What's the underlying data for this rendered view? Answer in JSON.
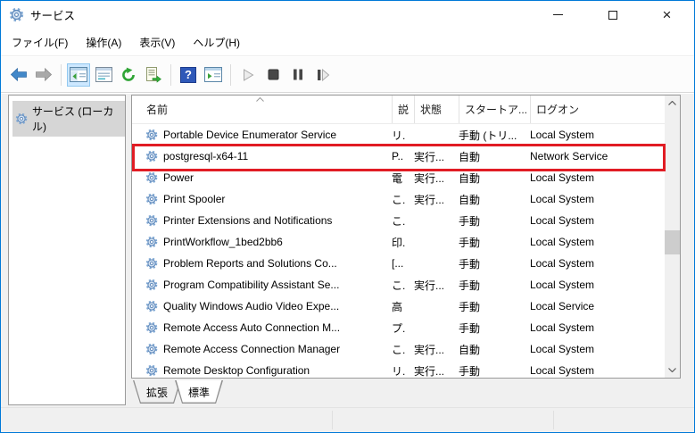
{
  "window": {
    "title": "サービス"
  },
  "titlebar": {
    "controls": [
      "minimize",
      "maximize",
      "close"
    ]
  },
  "menu": {
    "items": [
      {
        "label": "ファイル(F)"
      },
      {
        "label": "操作(A)"
      },
      {
        "label": "表示(V)"
      },
      {
        "label": "ヘルプ(H)"
      }
    ]
  },
  "toolbar": {
    "icons": [
      "back",
      "forward",
      "show-hide-console-tree",
      "properties",
      "refresh",
      "export-list",
      "help",
      "show-hide-action-pane",
      "start-service",
      "stop-service",
      "pause-service",
      "restart-service"
    ]
  },
  "sidebar": {
    "items": [
      {
        "label": "サービス (ローカル)",
        "selected": true
      }
    ]
  },
  "list": {
    "columns": [
      {
        "label": "名前",
        "sort": "asc"
      },
      {
        "label": "説"
      },
      {
        "label": "状態"
      },
      {
        "label": "スタートア..."
      },
      {
        "label": "ログオン"
      }
    ],
    "rows": [
      {
        "name": "Portable Device Enumerator Service",
        "desc": "リ.",
        "status": "",
        "startup": "手動 (トリ...",
        "logon": "Local System"
      },
      {
        "name": "postgresql-x64-11",
        "desc": "P..",
        "status": "実行...",
        "startup": "自動",
        "logon": "Network Service",
        "highlighted": true
      },
      {
        "name": "Power",
        "desc": "電",
        "status": "実行...",
        "startup": "自動",
        "logon": "Local System"
      },
      {
        "name": "Print Spooler",
        "desc": "こ.",
        "status": "実行...",
        "startup": "自動",
        "logon": "Local System"
      },
      {
        "name": "Printer Extensions and Notifications",
        "desc": "こ.",
        "status": "",
        "startup": "手動",
        "logon": "Local System"
      },
      {
        "name": "PrintWorkflow_1bed2bb6",
        "desc": "印.",
        "status": "",
        "startup": "手動",
        "logon": "Local System"
      },
      {
        "name": "Problem Reports and Solutions Co...",
        "desc": "[...",
        "status": "",
        "startup": "手動",
        "logon": "Local System"
      },
      {
        "name": "Program Compatibility Assistant Se...",
        "desc": "こ.",
        "status": "実行...",
        "startup": "手動",
        "logon": "Local System"
      },
      {
        "name": "Quality Windows Audio Video Expe...",
        "desc": "高",
        "status": "",
        "startup": "手動",
        "logon": "Local Service"
      },
      {
        "name": "Remote Access Auto Connection M...",
        "desc": "プ.",
        "status": "",
        "startup": "手動",
        "logon": "Local System"
      },
      {
        "name": "Remote Access Connection Manager",
        "desc": "こ.",
        "status": "実行...",
        "startup": "自動",
        "logon": "Local System"
      },
      {
        "name": "Remote Desktop Configuration",
        "desc": "リ.",
        "status": "実行...",
        "startup": "手動",
        "logon": "Local System"
      }
    ]
  },
  "tabs": {
    "items": [
      {
        "label": "拡張",
        "active": false
      },
      {
        "label": "標準",
        "active": true
      }
    ]
  },
  "annotation": {
    "type": "red-box",
    "target_row": "postgresql-x64-11",
    "color": "#e11c24"
  },
  "colors": {
    "window_border": "#0079d8",
    "selection_bg": "#d6d6d6",
    "toolbar_pressed_bg": "#cde8ff",
    "scrollbar_track": "#f0f0f0",
    "scrollbar_thumb": "#cdcdcd",
    "status_bar_bg": "#f0f0f0",
    "annotation_red": "#e11c24"
  }
}
